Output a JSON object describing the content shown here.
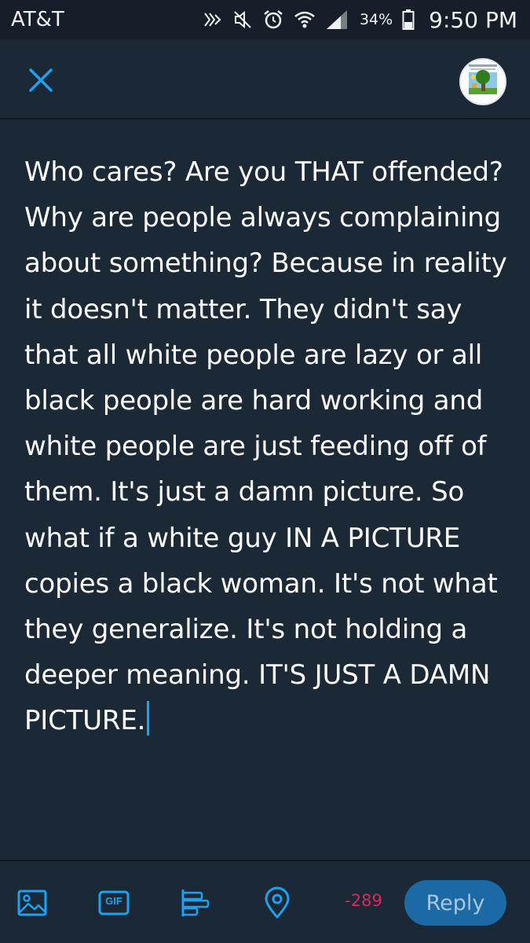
{
  "status_bar": {
    "carrier": "AT&T",
    "battery_percent": "34%",
    "time": "9:50 PM",
    "icons": [
      "nfc-icon",
      "mute-icon",
      "alarm-icon",
      "wifi-icon",
      "signal-icon",
      "battery-icon"
    ]
  },
  "header": {
    "close_icon": "close-icon",
    "avatar": "profile-avatar"
  },
  "composer": {
    "text": "Who cares? Are you THAT offended? Why are people always complaining about something? Because in reality it doesn't matter. They didn't say that all white people are lazy or all black people are hard working and white people are just feeding off of them. It's just a damn picture. So what if a white guy IN A PICTURE copies a black woman. It's not what they generalize. It's not holding a deeper meaning. IT'S JUST A DAMN PICTURE."
  },
  "toolbar": {
    "icons": [
      "image-icon",
      "gif-icon",
      "poll-icon",
      "location-icon"
    ],
    "gif_label": "GIF",
    "char_count": "-289",
    "reply_label": "Reply"
  },
  "colors": {
    "background": "#1b2836",
    "accent": "#1da1f2",
    "reply_button": "#1b6aa5",
    "over_limit": "#e0245e"
  }
}
